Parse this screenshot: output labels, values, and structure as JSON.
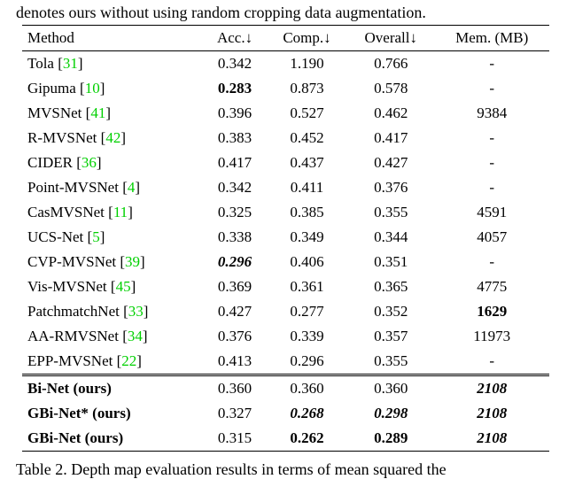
{
  "pretext": "denotes ours without using random cropping data augmentation.",
  "header": {
    "method": "Method",
    "acc": "Acc.↓",
    "comp": "Comp.↓",
    "overall": "Overall↓",
    "mem": "Mem. (MB)"
  },
  "rows": [
    {
      "name": "Tola",
      "cite": "31",
      "acc": "0.342",
      "comp": "1.190",
      "overall": "0.766",
      "mem": "-",
      "acc_cls": "",
      "comp_cls": "",
      "overall_cls": "",
      "mem_cls": ""
    },
    {
      "name": "Gipuma",
      "cite": "10",
      "acc": "0.283",
      "comp": "0.873",
      "overall": "0.578",
      "mem": "-",
      "acc_cls": "b",
      "comp_cls": "",
      "overall_cls": "",
      "mem_cls": ""
    },
    {
      "name": "MVSNet",
      "cite": "41",
      "acc": "0.396",
      "comp": "0.527",
      "overall": "0.462",
      "mem": "9384",
      "acc_cls": "",
      "comp_cls": "",
      "overall_cls": "",
      "mem_cls": ""
    },
    {
      "name": "R-MVSNet",
      "cite": "42",
      "acc": "0.383",
      "comp": "0.452",
      "overall": "0.417",
      "mem": "-",
      "acc_cls": "",
      "comp_cls": "",
      "overall_cls": "",
      "mem_cls": ""
    },
    {
      "name": "CIDER",
      "cite": "36",
      "acc": "0.417",
      "comp": "0.437",
      "overall": "0.427",
      "mem": "-",
      "acc_cls": "",
      "comp_cls": "",
      "overall_cls": "",
      "mem_cls": ""
    },
    {
      "name": "Point-MVSNet",
      "cite": "4",
      "acc": "0.342",
      "comp": "0.411",
      "overall": "0.376",
      "mem": "-",
      "acc_cls": "",
      "comp_cls": "",
      "overall_cls": "",
      "mem_cls": ""
    },
    {
      "name": "CasMVSNet",
      "cite": "11",
      "acc": "0.325",
      "comp": "0.385",
      "overall": "0.355",
      "mem": "4591",
      "acc_cls": "",
      "comp_cls": "",
      "overall_cls": "",
      "mem_cls": ""
    },
    {
      "name": "UCS-Net",
      "cite": "5",
      "acc": "0.338",
      "comp": "0.349",
      "overall": "0.344",
      "mem": "4057",
      "acc_cls": "",
      "comp_cls": "",
      "overall_cls": "",
      "mem_cls": ""
    },
    {
      "name": "CVP-MVSNet",
      "cite": "39",
      "acc": "0.296",
      "comp": "0.406",
      "overall": "0.351",
      "mem": "-",
      "acc_cls": "bi",
      "comp_cls": "",
      "overall_cls": "",
      "mem_cls": ""
    },
    {
      "name": "Vis-MVSNet",
      "cite": "45",
      "acc": "0.369",
      "comp": "0.361",
      "overall": "0.365",
      "mem": "4775",
      "acc_cls": "",
      "comp_cls": "",
      "overall_cls": "",
      "mem_cls": ""
    },
    {
      "name": "PatchmatchNet",
      "cite": "33",
      "acc": "0.427",
      "comp": "0.277",
      "overall": "0.352",
      "mem": "1629",
      "acc_cls": "",
      "comp_cls": "",
      "overall_cls": "",
      "mem_cls": "b"
    },
    {
      "name": "AA-RMVSNet",
      "cite": "34",
      "acc": "0.376",
      "comp": "0.339",
      "overall": "0.357",
      "mem": "11973",
      "acc_cls": "",
      "comp_cls": "",
      "overall_cls": "",
      "mem_cls": ""
    },
    {
      "name": "EPP-MVSNet",
      "cite": "22",
      "acc": "0.413",
      "comp": "0.296",
      "overall": "0.355",
      "mem": "-",
      "acc_cls": "",
      "comp_cls": "",
      "overall_cls": "",
      "mem_cls": ""
    }
  ],
  "ours": [
    {
      "name": "Bi-Net (ours)",
      "acc": "0.360",
      "comp": "0.360",
      "overall": "0.360",
      "mem": "2108",
      "name_cls": "b",
      "acc_cls": "",
      "comp_cls": "",
      "overall_cls": "",
      "mem_cls": "bi"
    },
    {
      "name": "GBi-Net* (ours)",
      "acc": "0.327",
      "comp": "0.268",
      "overall": "0.298",
      "mem": "2108",
      "name_cls": "b",
      "acc_cls": "",
      "comp_cls": "bi",
      "overall_cls": "bi",
      "mem_cls": "bi"
    },
    {
      "name": "GBi-Net (ours)",
      "acc": "0.315",
      "comp": "0.262",
      "overall": "0.289",
      "mem": "2108",
      "name_cls": "b",
      "acc_cls": "",
      "comp_cls": "b",
      "overall_cls": "b",
      "mem_cls": "bi"
    }
  ],
  "caption_prefix": "Table 2. ",
  "caption_text": "Depth map evaluation results in terms of mean squared the",
  "chart_data": {
    "type": "table",
    "title": "Quantitative comparison of MVS methods (lower is better for Acc., Comp., Overall)",
    "columns": [
      "Method",
      "Acc.↓",
      "Comp.↓",
      "Overall↓",
      "Mem. (MB)"
    ],
    "rows": [
      [
        "Tola [31]",
        0.342,
        1.19,
        0.766,
        null
      ],
      [
        "Gipuma [10]",
        0.283,
        0.873,
        0.578,
        null
      ],
      [
        "MVSNet [41]",
        0.396,
        0.527,
        0.462,
        9384
      ],
      [
        "R-MVSNet [42]",
        0.383,
        0.452,
        0.417,
        null
      ],
      [
        "CIDER [36]",
        0.417,
        0.437,
        0.427,
        null
      ],
      [
        "Point-MVSNet [4]",
        0.342,
        0.411,
        0.376,
        null
      ],
      [
        "CasMVSNet [11]",
        0.325,
        0.385,
        0.355,
        4591
      ],
      [
        "UCS-Net [5]",
        0.338,
        0.349,
        0.344,
        4057
      ],
      [
        "CVP-MVSNet [39]",
        0.296,
        0.406,
        0.351,
        null
      ],
      [
        "Vis-MVSNet [45]",
        0.369,
        0.361,
        0.365,
        4775
      ],
      [
        "PatchmatchNet [33]",
        0.427,
        0.277,
        0.352,
        1629
      ],
      [
        "AA-RMVSNet [34]",
        0.376,
        0.339,
        0.357,
        11973
      ],
      [
        "EPP-MVSNet [22]",
        0.413,
        0.296,
        0.355,
        null
      ],
      [
        "Bi-Net (ours)",
        0.36,
        0.36,
        0.36,
        2108
      ],
      [
        "GBi-Net* (ours)",
        0.327,
        0.268,
        0.298,
        2108
      ],
      [
        "GBi-Net (ours)",
        0.315,
        0.262,
        0.289,
        2108
      ]
    ]
  }
}
